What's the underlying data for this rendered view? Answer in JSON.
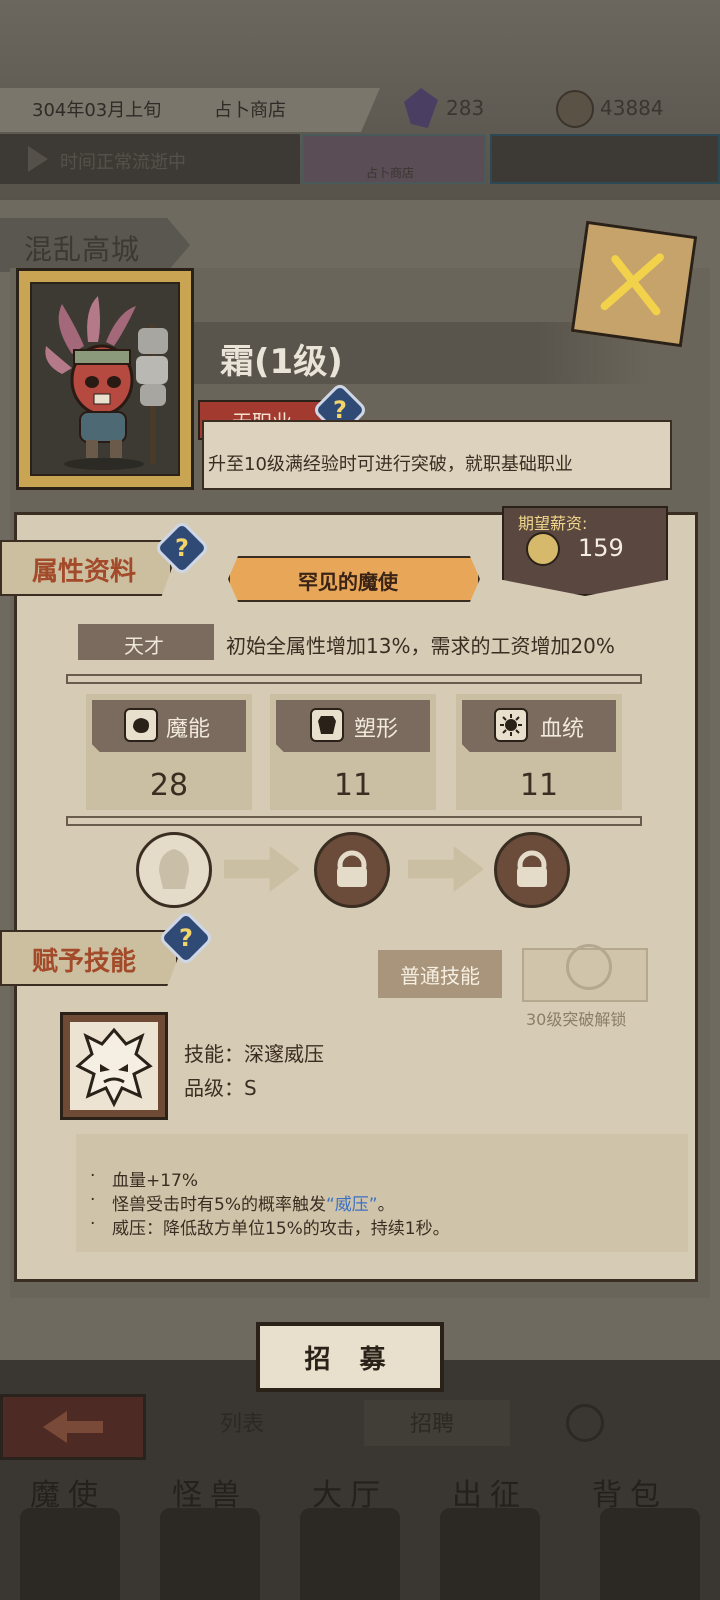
{
  "top_bar": {
    "date": "304年03月上旬",
    "location": "占卜商店",
    "gems": "283",
    "coins": "43884",
    "time_status": "时间正常流逝中",
    "shop_thumb_label": "占卜商店"
  },
  "area": {
    "name": "混乱高城"
  },
  "unit": {
    "name": "霜(1级)",
    "class": "无职业",
    "class_hint": "升至10级满经验时可进行突破，就职基础职业",
    "expected_salary_label": "期望薪资:",
    "expected_salary": "159",
    "rarity": "罕见的魔使"
  },
  "attributes": {
    "section_title": "属性资料",
    "talent_label": "天才",
    "talent_desc": "初始全属性增加13%，需求的工资增加20%",
    "stats": [
      {
        "name": "魔能",
        "value": "28",
        "icon": "fist-icon"
      },
      {
        "name": "塑形",
        "value": "11",
        "icon": "armor-icon"
      },
      {
        "name": "血统",
        "value": "11",
        "icon": "sun-icon"
      }
    ]
  },
  "skills": {
    "section_title": "赋予技能",
    "normal_skill_label": "普通技能",
    "unlock_text": "30级突破解锁",
    "skill_name": "技能：深邃威压",
    "skill_grade": "品级：S",
    "desc": {
      "line1": "血量+17%",
      "line2_pre": "怪兽受击时有5%的概率触发",
      "line2_kw": "“威压”",
      "line2_post": "。",
      "line3": "威压：降低敌方单位15%的攻击，持续1秒。"
    }
  },
  "recruit_button": "招 募",
  "bottom_tabs": {
    "list": "列表",
    "hire": "招聘"
  },
  "nav": [
    "魔使",
    "怪兽",
    "大厅",
    "出征",
    "背包"
  ],
  "colors": {
    "accent_red": "#a34a2a",
    "keyword_blue": "#3d71c4",
    "banner_orange": "#e8a659"
  }
}
